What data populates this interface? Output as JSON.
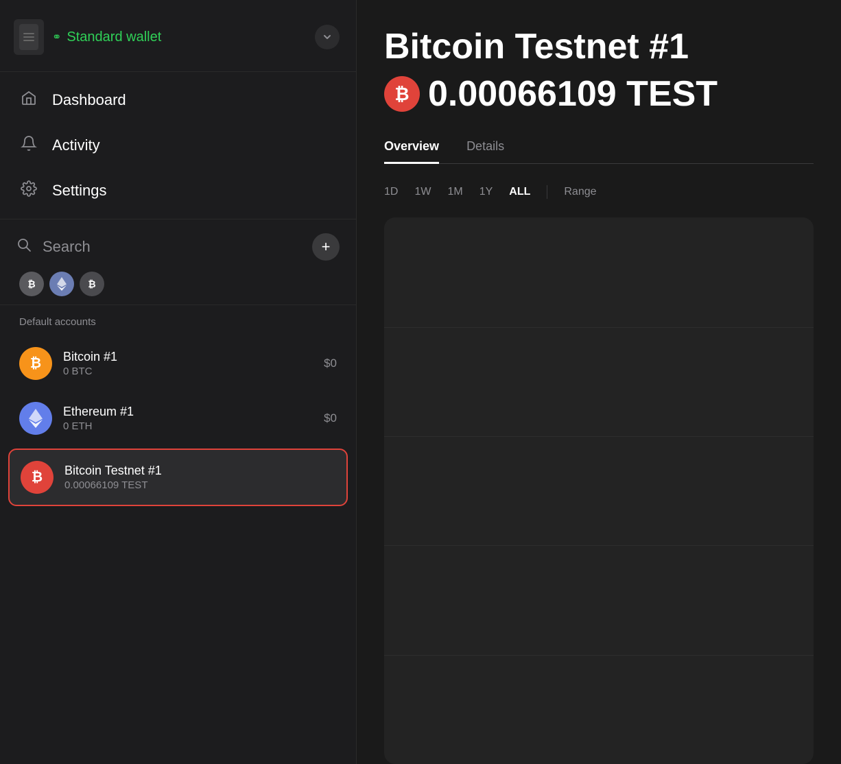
{
  "sidebar": {
    "wallet_name": "Standard wallet",
    "hardware_icon_alt": "hardware wallet device",
    "nav": [
      {
        "id": "dashboard",
        "label": "Dashboard",
        "icon": "⌂"
      },
      {
        "id": "activity",
        "label": "Activity",
        "icon": "🔔"
      },
      {
        "id": "settings",
        "label": "Settings",
        "icon": "⚙"
      }
    ],
    "search_placeholder": "Search",
    "add_button_label": "+",
    "accounts_section_label": "Default accounts",
    "accounts": [
      {
        "id": "bitcoin-1",
        "name": "Bitcoin #1",
        "crypto_balance": "0 BTC",
        "usd_balance": "$0",
        "coin": "BTC",
        "coin_type": "btc-orange"
      },
      {
        "id": "ethereum-1",
        "name": "Ethereum #1",
        "crypto_balance": "0 ETH",
        "usd_balance": "$0",
        "coin": "ETH",
        "coin_type": "eth-purple"
      },
      {
        "id": "bitcoin-testnet-1",
        "name": "Bitcoin Testnet #1",
        "crypto_balance": "0.00066109 TEST",
        "usd_balance": "",
        "coin": "₿",
        "coin_type": "btc-red",
        "selected": true
      }
    ]
  },
  "main": {
    "asset_title": "Bitcoin Testnet #1",
    "asset_balance": "0.00066109 TEST",
    "btc_icon_label": "₿",
    "tabs": [
      {
        "id": "overview",
        "label": "Overview",
        "active": true
      },
      {
        "id": "details",
        "label": "Details",
        "active": false
      }
    ],
    "time_ranges": [
      {
        "id": "1d",
        "label": "1D",
        "active": false
      },
      {
        "id": "1w",
        "label": "1W",
        "active": false
      },
      {
        "id": "1m",
        "label": "1M",
        "active": false
      },
      {
        "id": "1y",
        "label": "1Y",
        "active": false
      },
      {
        "id": "all",
        "label": "ALL",
        "active": true
      },
      {
        "id": "range",
        "label": "Range",
        "active": false
      }
    ]
  },
  "icons": {
    "link_icon": "⚭",
    "chevron_down": "⌄",
    "search": "🔍",
    "home": "⌂",
    "bell": "🔔",
    "gear": "⚙",
    "plus": "+"
  }
}
